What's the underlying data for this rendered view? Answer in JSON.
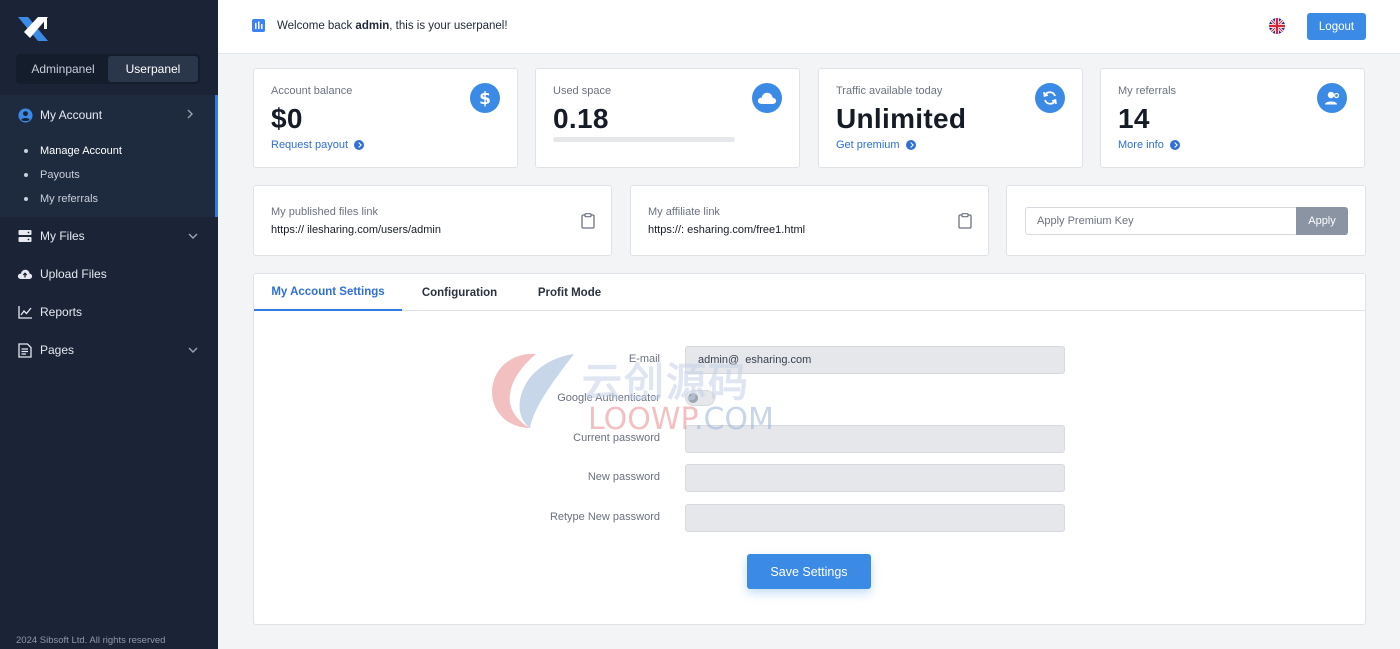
{
  "sidebar": {
    "panel_switch": [
      "Adminpanel",
      "Userpanel"
    ],
    "nav": {
      "my_account": "My Account",
      "sub_items": [
        "Manage Account",
        "Payouts",
        "My referrals"
      ],
      "my_files": "My Files",
      "upload_files": "Upload Files",
      "reports": "Reports",
      "pages": "Pages"
    },
    "footer": "2024 Sibsoft Ltd. All rights reserved"
  },
  "topbar": {
    "welcome_prefix": "Welcome back",
    "username": "admin",
    "welcome_suffix": ", this is your userpanel!",
    "logout_label": "Logout",
    "accent_color": "#3b8be6"
  },
  "stats": {
    "balance": {
      "label": "Account balance",
      "value": "$0",
      "link": "Request payout"
    },
    "space": {
      "label": "Used space",
      "value": "0.18",
      "progress": 0
    },
    "traffic": {
      "label": "Traffic available today",
      "value": "Unlimited",
      "link": "Get premium"
    },
    "referrals": {
      "label": "My referrals",
      "value": "14",
      "link": "More info"
    }
  },
  "links": {
    "published": {
      "label": "My published files link",
      "url": "https://  ilesharing.com/users/admin"
    },
    "affiliate": {
      "label": "My affiliate link",
      "url": "https://:  esharing.com/free1.html"
    },
    "premium_key": {
      "placeholder": "Apply Premium Key",
      "button": "Apply"
    }
  },
  "settings": {
    "tabs": [
      "My Account Settings",
      "Configuration",
      "Profit Mode"
    ],
    "fields": {
      "email_label": "E-mail",
      "email_value": "admin@  esharing.com",
      "google_auth_label": "Google Authenticator",
      "current_password_label": "Current password",
      "new_password_label": "New password",
      "retype_password_label": "Retype New password"
    },
    "save_label": "Save Settings"
  },
  "watermark": {
    "cn": "云创源码",
    "en_main": "LOOWP",
    "en_suffix": ".COM"
  }
}
